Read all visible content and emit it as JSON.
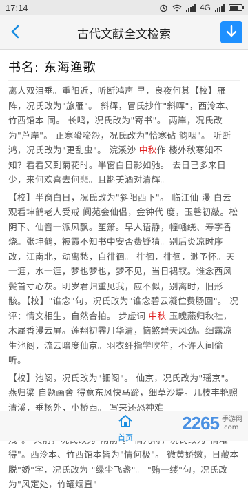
{
  "status": {
    "time": "17:14",
    "network": "4G",
    "battery_level": 0.7
  },
  "header": {
    "title": "古代文献全文检索"
  },
  "book": {
    "title": "书名: 东海渔歌"
  },
  "paragraphs": [
    [
      {
        "t": "离人双泪垂。重阳近，听断鸿声 里，良夜何其【校】雁阵，况氏改为\"旅雁\"。 斜辉，冒氏抄作\"斜晖\"，西泠本、竹西馆本 同。 长鸣，况氏改为\"寄书\"。 两岸，况氏改为\"芦岸\"。 正寒蛩啼怨，况氏改为\"恰寒砧 韵咽\"。 听断鸿，况氏改为\"更乱虫\"。 浣溪沙 "
      },
      {
        "t": "中秋",
        "hl": true
      },
      {
        "t": "作 楼外秋寒知不知？看看又到菊花时。半窗白日影如驰。 去日已多来日少，来何欢喜去何悲。且斟美酒对清辉。"
      }
    ],
    [
      {
        "t": "【校】半窗白日，况氏改为\"斜阳西下\"。 临江仙 漫 白云观看坤鹤老人受戒 阆苑会仙侣，金钟代 度，玉磬初敲。松阴下、仙音一派风飘。笙箫。早人语静，幢幡绕、寿字香烧。张坤鹤，被霞不知书中安否费疑猜。别后炎凉时序改，江南北，动离愁，自徘徊。 徘徊，徘徊，渺予怀。天一涯，水一涯，梦也梦也，梦不见，当日裙钗。谁念西风鬓首寸心灰。明岁君归重见我，应不似，别离时，旧形骸。【校】\"谁念\"句，况氏改为\"谁念碧云凝伫费肠回\"。 况评：情文相生，自然合拍。 步虚词 "
      },
      {
        "t": "中秋",
        "hl": true
      },
      {
        "t": " 玉魄燕归秋社，木犀香漫云屏。莲翔初霁月华清，恼煞碧天风劲。细露凉生池阁，流云暗度仙京。羽衣纤指学吹笙，不许人间偷听。"
      }
    ],
    [
      {
        "t": "【校】池阁，况氏改为\"钿阁\"。 仙京，况氏改为\"瑶京\"。 燕归梁 自题画舍 得意东风快马蹄，细草沙堤。几枝丰艳照清溪，垂杨外，小桥西。 写来还恐神难"
      }
    ],
    [
      {
        "t": "【校】病肋，况氏改为\"病里\"。 闷无聊，况氏改为\"落花残\"。 火前，况氏改为\"雨前\"。 情儿特，况氏改为\"情难得\"。西泠本、竹西馆本皆为\"情何极\"。 微黄娇嫩，日藏本脱\"娇\"字，况氏改为 \"绿尘飞盏\"。 \"贿一缕\"句，况氏改为\"风定处，竹罐烟直\""
      }
    ]
  ],
  "nav": {
    "home_label": "首页"
  },
  "watermark": {
    "number": "2265",
    "suffix": ".com",
    "site_name": "手游网"
  }
}
